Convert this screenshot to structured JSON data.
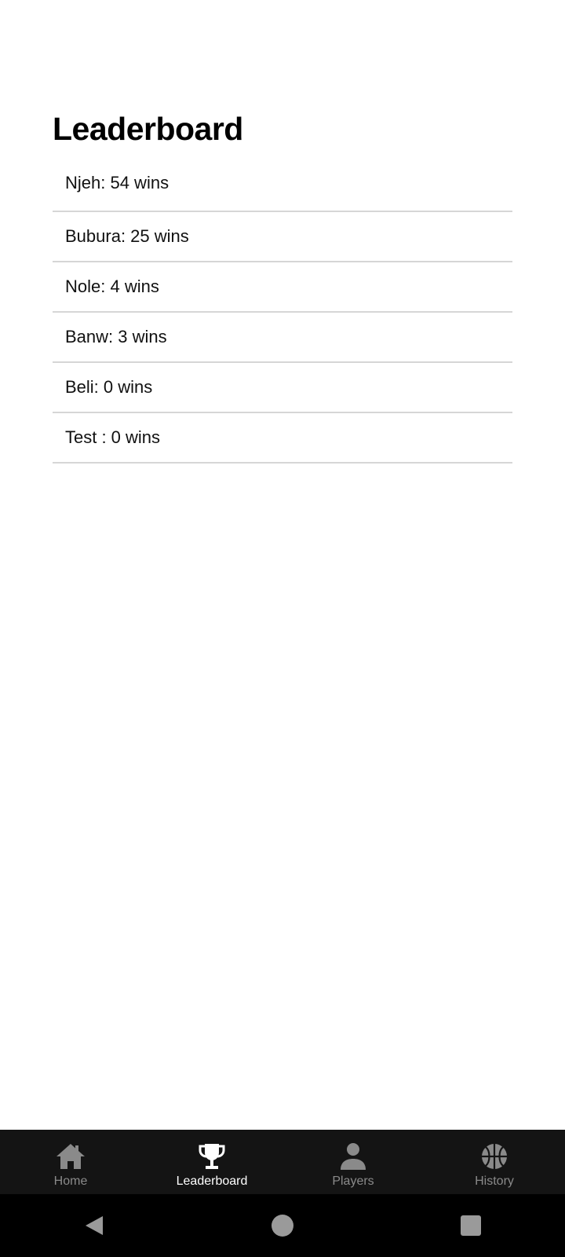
{
  "page": {
    "title": "Leaderboard"
  },
  "leaderboard": {
    "entries": [
      {
        "text": "Njeh: 54 wins"
      },
      {
        "text": "Bubura: 25 wins"
      },
      {
        "text": "Nole: 4 wins"
      },
      {
        "text": "Banw: 3 wins"
      },
      {
        "text": "Beli: 0 wins"
      },
      {
        "text": "Test : 0 wins"
      }
    ]
  },
  "bottom_nav": {
    "items": [
      {
        "label": "Home",
        "icon": "home-icon",
        "active": false
      },
      {
        "label": "Leaderboard",
        "icon": "trophy-icon",
        "active": true
      },
      {
        "label": "Players",
        "icon": "person-icon",
        "active": false
      },
      {
        "label": "History",
        "icon": "basketball-icon",
        "active": false
      }
    ],
    "colors": {
      "background": "#141414",
      "active": "#ffffff",
      "inactive": "#8a8a8a"
    }
  },
  "system_nav": {
    "buttons": [
      "back-icon",
      "home-circle-icon",
      "recents-icon"
    ]
  }
}
